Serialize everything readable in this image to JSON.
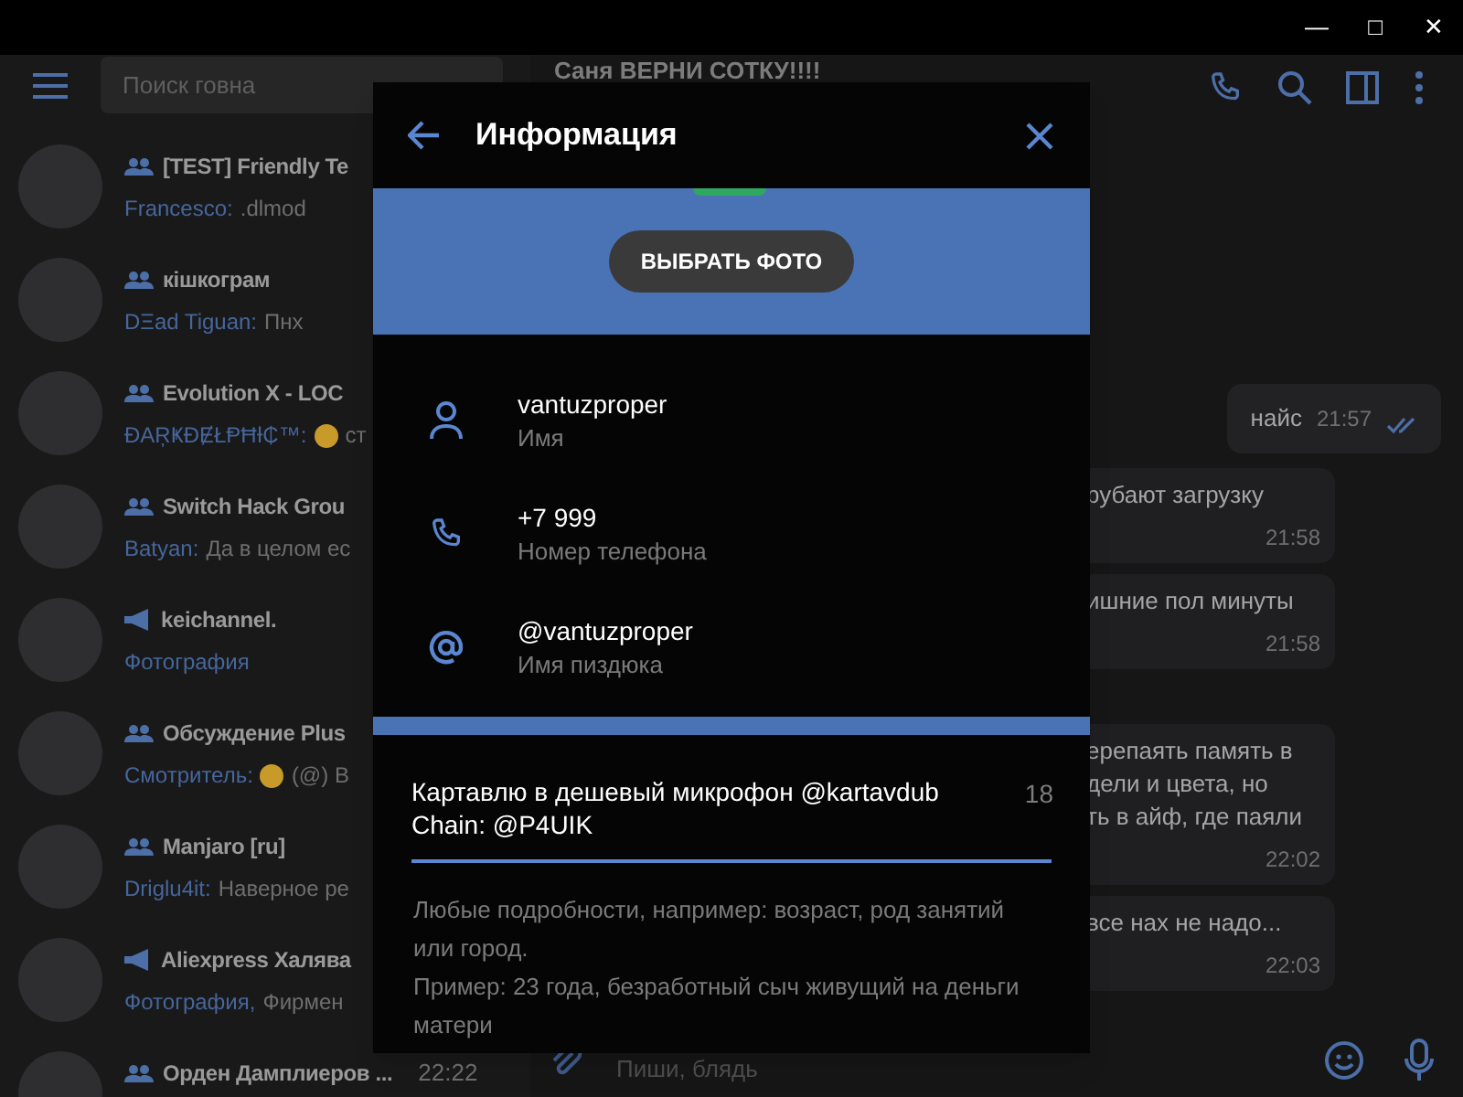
{
  "window_controls": [
    "—",
    "□",
    "✕"
  ],
  "search": {
    "placeholder": "Поиск говна"
  },
  "chats": [
    {
      "kind": "group",
      "title": "[TEST] Friendly Te",
      "preview": [
        {
          "kind": "sender",
          "text": "Francesco:"
        },
        {
          "kind": "text",
          "text": ".dlmod"
        }
      ]
    },
    {
      "kind": "group",
      "title": "кішкограм",
      "preview": [
        {
          "kind": "sender",
          "text": "DΞad Tiguan:"
        },
        {
          "kind": "text",
          "text": "Пнх"
        }
      ]
    },
    {
      "kind": "group",
      "title": "Evolution X - LOC",
      "preview": [
        {
          "kind": "sender",
          "text": "ĐAŖҜĐɆŁⱣĦƗ₵™:"
        },
        {
          "kind": "emoji"
        },
        {
          "kind": "text",
          "text": "ст"
        }
      ]
    },
    {
      "kind": "group",
      "title": "Switch Hack Grou",
      "preview": [
        {
          "kind": "sender",
          "text": "Batyan:"
        },
        {
          "kind": "text",
          "text": "Да в целом ес"
        }
      ]
    },
    {
      "kind": "channel",
      "title": "keichannel.",
      "preview": [
        {
          "kind": "media",
          "text": "Фотография"
        }
      ]
    },
    {
      "kind": "group",
      "title": "Обсуждение Plus",
      "preview": [
        {
          "kind": "sender",
          "text": "Смотритель:"
        },
        {
          "kind": "emoji"
        },
        {
          "kind": "text",
          "text": "(@) В"
        }
      ]
    },
    {
      "kind": "group",
      "title": "Manjaro [ru]",
      "preview": [
        {
          "kind": "sender",
          "text": "Driglu4it:"
        },
        {
          "kind": "text",
          "text": "Наверное ре"
        }
      ]
    },
    {
      "kind": "channel",
      "title": "Aliexpress Халява",
      "preview": [
        {
          "kind": "media",
          "text": "Фотография,"
        },
        {
          "kind": "text",
          "text": "Фирмен"
        }
      ]
    },
    {
      "kind": "group",
      "title": "Орден Дамплиеров ...",
      "time": "22:22"
    }
  ],
  "chat": {
    "title": "Саня ВЕРНИ СОТКУ!!!!",
    "input_placeholder": "Пиши, блядь",
    "messages": [
      {
        "outgoing": true,
        "lines": [
          "найс"
        ],
        "time": "21:57"
      },
      {
        "outgoing": false,
        "lines": [
          "рубают загрузку"
        ],
        "time": "21:58"
      },
      {
        "outgoing": false,
        "lines": [
          "ишние пол минуты"
        ],
        "time": "21:58"
      },
      {
        "outgoing": false,
        "lines": [
          "ерепаять память в",
          "дели и цвета, но",
          "ть в айф, где паяли"
        ],
        "time": "22:02"
      },
      {
        "outgoing": false,
        "lines": [
          "все нах не надо..."
        ],
        "time": "22:03"
      }
    ]
  },
  "dialog": {
    "title": "Информация",
    "photo_button": "ВЫБРАТЬ ФОТО",
    "fields": [
      {
        "kind": "name",
        "value": "vantuzproper",
        "label": "Имя"
      },
      {
        "kind": "phone",
        "value": "+7 999",
        "label": "Номер телефона"
      },
      {
        "kind": "username",
        "value": "@vantuzproper",
        "label": "Имя пиздюка"
      }
    ],
    "bio": {
      "lines": [
        "Картавлю в дешевый микрофон @kartavdub",
        "Chain: @P4UIK"
      ],
      "counter": "18"
    },
    "hint": [
      "Любые подробности, например: возраст, род занятий или город.",
      "Пример: 23 года, безработный сыч живущий на деньги матери"
    ]
  }
}
